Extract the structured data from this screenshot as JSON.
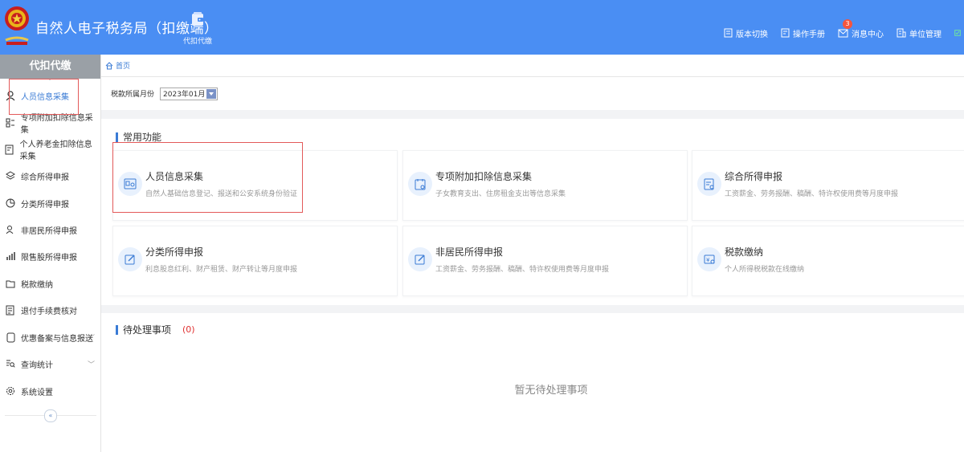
{
  "header": {
    "app_title": "自然人电子税务局（扣缴端）",
    "module": {
      "label": "代扣代缴",
      "icon": "wallet-icon"
    },
    "links": [
      {
        "label": "版本切换",
        "icon": "document-icon"
      },
      {
        "label": "操作手册",
        "icon": "manual-icon"
      },
      {
        "label": "消息中心",
        "icon": "mail-icon",
        "badge": "3"
      },
      {
        "label": "单位管理",
        "icon": "building-icon"
      }
    ],
    "colors": {
      "bar": "#4a8ef3",
      "badge": "#f5553d"
    }
  },
  "sidebar": {
    "title": "代扣代缴",
    "items": [
      {
        "label": "人员信息采集",
        "icon": "person-icon",
        "active": true
      },
      {
        "label": "专项附加扣除信息采集",
        "icon": "grid-list-icon"
      },
      {
        "label": "个人养老金扣除信息采集",
        "icon": "pension-doc-icon"
      },
      {
        "label": "综合所得申报",
        "icon": "layers-icon"
      },
      {
        "label": "分类所得申报",
        "icon": "pie-icon"
      },
      {
        "label": "非居民所得申报",
        "icon": "user-outline-icon"
      },
      {
        "label": "限售股所得申报",
        "icon": "bar-chart-icon"
      },
      {
        "label": "税款缴纳",
        "icon": "folder-icon"
      },
      {
        "label": "退付手续费核对",
        "icon": "receipt-icon"
      },
      {
        "label": "优惠备案与信息报送",
        "icon": "doc-icon",
        "expandable": true
      },
      {
        "label": "查询统计",
        "icon": "search-list-icon",
        "expandable": true
      },
      {
        "label": "系统设置",
        "icon": "gear-icon"
      }
    ],
    "collapse_icon": "double-chevron-left-icon"
  },
  "breadcrumb": {
    "home": "首页",
    "icon": "home-icon"
  },
  "filter": {
    "label": "税款所属月份",
    "value": "2023年01月"
  },
  "common": {
    "title": "常用功能",
    "cards": [
      {
        "title": "人员信息采集",
        "desc": "自然人基础信息登记、报送和公安系统身份验证",
        "icon": "id-card-icon"
      },
      {
        "title": "专项附加扣除信息采集",
        "desc": "子女教育支出、住房租金支出等信息采集",
        "icon": "calendar-doc-icon"
      },
      {
        "title": "综合所得申报",
        "desc": "工资薪金、劳务报酬、稿酬、特许权使用费等月度申报",
        "icon": "form-doc-icon"
      },
      {
        "title": "分类所得申报",
        "desc": "利息股息红利、财产租赁、财产转让等月度申报",
        "icon": "edit-icon"
      },
      {
        "title": "非居民所得申报",
        "desc": "工资薪金、劳务报酬、稿酬、特许权使用费等月度申报",
        "icon": "edit-icon"
      },
      {
        "title": "税款缴纳",
        "desc": "个人所得税税款在线缴纳",
        "icon": "tax-pay-icon"
      }
    ]
  },
  "todo": {
    "title": "待处理事项",
    "count": "(0)",
    "empty": "暂无待处理事项"
  }
}
